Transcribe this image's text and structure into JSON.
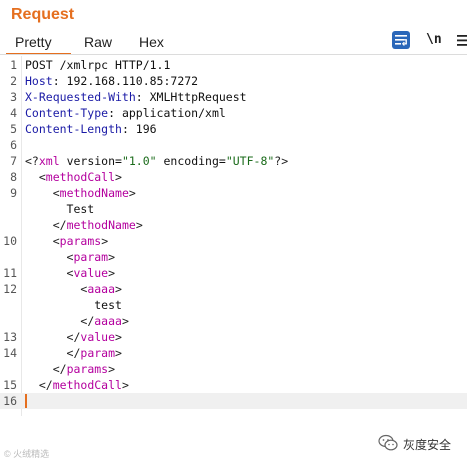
{
  "panel": {
    "title": "Request"
  },
  "tabs": [
    {
      "label": "Pretty",
      "active": true
    },
    {
      "label": "Raw",
      "active": false
    },
    {
      "label": "Hex",
      "active": false
    }
  ],
  "toolbar": {
    "pretty_icon": "pretty-print-icon",
    "newline_label": "\\n",
    "menu_icon": "menu-icon"
  },
  "colors": {
    "accent": "#e56f1f",
    "toolbar_blue": "#2a67b9",
    "tag": "#b4009e",
    "header_key": "#1a1aa6",
    "attr_value": "#1a6b1a"
  },
  "editor": {
    "lines": [
      {
        "n": "1",
        "parts": [
          {
            "k": "txt",
            "v": "POST /xmlrpc HTTP/1.1"
          }
        ]
      },
      {
        "n": "2",
        "parts": [
          {
            "k": "hk",
            "v": "Host"
          },
          {
            "k": "txt",
            "v": ": 192.168.110.85:7272"
          }
        ]
      },
      {
        "n": "3",
        "parts": [
          {
            "k": "hk",
            "v": "X-Requested-With"
          },
          {
            "k": "txt",
            "v": ": XMLHttpRequest"
          }
        ]
      },
      {
        "n": "4",
        "parts": [
          {
            "k": "hk",
            "v": "Content-Type"
          },
          {
            "k": "txt",
            "v": ": application/xml"
          }
        ]
      },
      {
        "n": "5",
        "parts": [
          {
            "k": "hk",
            "v": "Content-Length"
          },
          {
            "k": "txt",
            "v": ": 196"
          }
        ]
      },
      {
        "n": "6",
        "parts": []
      },
      {
        "n": "7",
        "parts": [
          {
            "k": "p",
            "v": "<?"
          },
          {
            "k": "t",
            "v": "xml"
          },
          {
            "k": "txt",
            "v": " version="
          },
          {
            "k": "av",
            "v": "\"1.0\""
          },
          {
            "k": "txt",
            "v": " encoding="
          },
          {
            "k": "av",
            "v": "\"UTF-8\""
          },
          {
            "k": "p",
            "v": "?>"
          }
        ]
      },
      {
        "n": "8",
        "parts": [
          {
            "k": "txt",
            "v": "  "
          },
          {
            "k": "p",
            "v": "<"
          },
          {
            "k": "t",
            "v": "methodCall"
          },
          {
            "k": "p",
            "v": ">"
          }
        ]
      },
      {
        "n": "9",
        "parts": [
          {
            "k": "txt",
            "v": "    "
          },
          {
            "k": "p",
            "v": "<"
          },
          {
            "k": "t",
            "v": "methodName"
          },
          {
            "k": "p",
            "v": ">"
          }
        ]
      },
      {
        "n": "",
        "parts": [
          {
            "k": "txt",
            "v": "      Test"
          }
        ]
      },
      {
        "n": "",
        "parts": [
          {
            "k": "txt",
            "v": "    "
          },
          {
            "k": "p",
            "v": "</"
          },
          {
            "k": "t",
            "v": "methodName"
          },
          {
            "k": "p",
            "v": ">"
          }
        ]
      },
      {
        "n": "10",
        "parts": [
          {
            "k": "txt",
            "v": "    "
          },
          {
            "k": "p",
            "v": "<"
          },
          {
            "k": "t",
            "v": "params"
          },
          {
            "k": "p",
            "v": ">"
          }
        ]
      },
      {
        "n": "",
        "parts": [
          {
            "k": "txt",
            "v": "      "
          },
          {
            "k": "p",
            "v": "<"
          },
          {
            "k": "t",
            "v": "param"
          },
          {
            "k": "p",
            "v": ">"
          }
        ]
      },
      {
        "n": "11",
        "parts": [
          {
            "k": "txt",
            "v": "      "
          },
          {
            "k": "p",
            "v": "<"
          },
          {
            "k": "t",
            "v": "value"
          },
          {
            "k": "p",
            "v": ">"
          }
        ]
      },
      {
        "n": "12",
        "parts": [
          {
            "k": "txt",
            "v": "        "
          },
          {
            "k": "p",
            "v": "<"
          },
          {
            "k": "t",
            "v": "aaaa"
          },
          {
            "k": "p",
            "v": ">"
          }
        ]
      },
      {
        "n": "",
        "parts": [
          {
            "k": "txt",
            "v": "          test"
          }
        ]
      },
      {
        "n": "",
        "parts": [
          {
            "k": "txt",
            "v": "        "
          },
          {
            "k": "p",
            "v": "</"
          },
          {
            "k": "t",
            "v": "aaaa"
          },
          {
            "k": "p",
            "v": ">"
          }
        ]
      },
      {
        "n": "13",
        "parts": [
          {
            "k": "txt",
            "v": "      "
          },
          {
            "k": "p",
            "v": "</"
          },
          {
            "k": "t",
            "v": "value"
          },
          {
            "k": "p",
            "v": ">"
          }
        ]
      },
      {
        "n": "14",
        "parts": [
          {
            "k": "txt",
            "v": "      "
          },
          {
            "k": "p",
            "v": "</"
          },
          {
            "k": "t",
            "v": "param"
          },
          {
            "k": "p",
            "v": ">"
          }
        ]
      },
      {
        "n": "",
        "parts": [
          {
            "k": "txt",
            "v": "    "
          },
          {
            "k": "p",
            "v": "</"
          },
          {
            "k": "t",
            "v": "params"
          },
          {
            "k": "p",
            "v": ">"
          }
        ]
      },
      {
        "n": "15",
        "parts": [
          {
            "k": "txt",
            "v": "  "
          },
          {
            "k": "p",
            "v": "</"
          },
          {
            "k": "t",
            "v": "methodCall"
          },
          {
            "k": "p",
            "v": ">"
          }
        ]
      },
      {
        "n": "16",
        "parts": []
      }
    ]
  },
  "watermarks": {
    "left": "© 火绒精选",
    "right_icon": "wechat-icon",
    "right_text": "灰度安全"
  }
}
